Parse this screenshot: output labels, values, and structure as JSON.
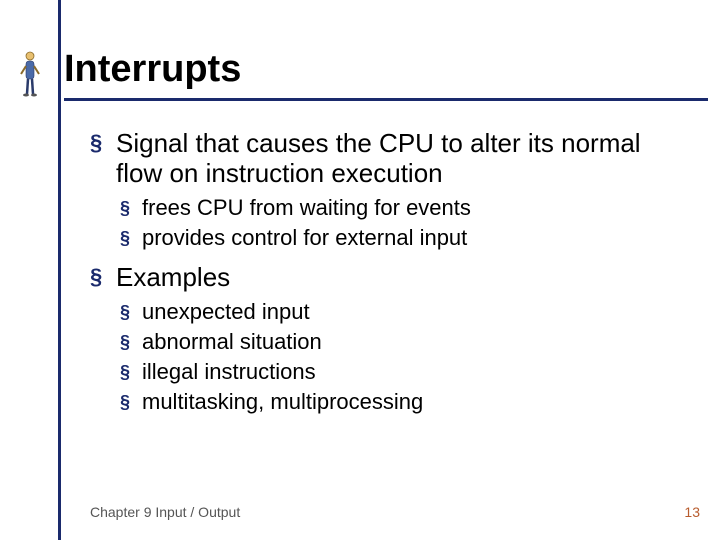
{
  "title": "Interrupts",
  "bullets": {
    "l1_0": "Signal that causes the CPU to alter its normal flow on instruction execution",
    "l1_0_sub": [
      "frees CPU from waiting for events",
      "provides control for external input"
    ],
    "l1_1": "Examples",
    "l1_1_sub": [
      "unexpected input",
      "abnormal situation",
      "illegal instructions",
      "multitasking, multiprocessing"
    ]
  },
  "footer": {
    "left": "Chapter 9 Input / Output",
    "right": "13"
  },
  "glyph": "§"
}
